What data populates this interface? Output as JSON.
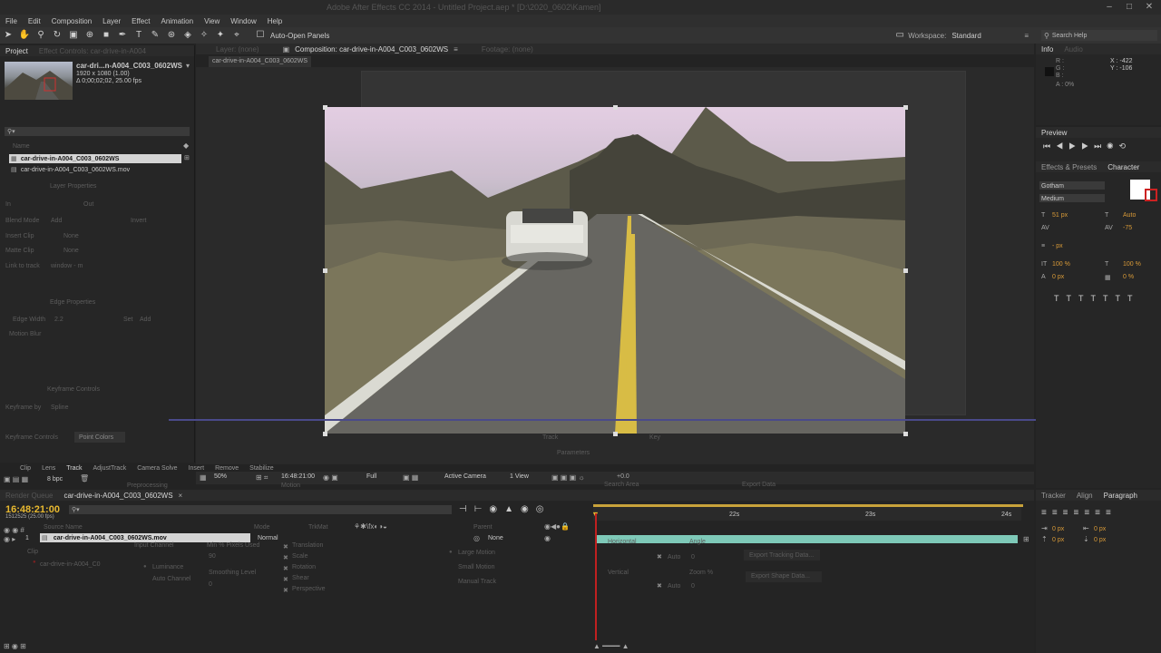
{
  "app_title": "Adobe After Effects CC 2014 - Untitled Project.aep * [D:\\2020_0602\\Kamen]",
  "menu": [
    "File",
    "Edit",
    "Composition",
    "Layer",
    "Effect",
    "Animation",
    "View",
    "Window",
    "Help"
  ],
  "toolbar": {
    "auto_open": "Auto-Open Panels",
    "workspace_label": "Workspace:",
    "workspace_value": "Standard",
    "search_help": "Search Help"
  },
  "project": {
    "tabs": [
      "Project",
      "Effect Controls: car-drive-in-A004"
    ],
    "item_name": "car-dri...n-A004_C003_0602WS",
    "item_res": "1920 x 1080 (1.00)",
    "item_dur": "Δ 0;00;02;02, 25.00 fps",
    "search_placeholder": "",
    "col_name": "Name",
    "row1": "car-drive-in-A004_C003_0602WS",
    "row2": "car-drive-in-A004_C003_0602WS.mov",
    "layer_props": "Layer Properties",
    "in_label": "In",
    "out_label": "Out",
    "blend_mode": "Blend Mode",
    "blend_value": "Add",
    "invert": "Invert",
    "insert_clip": "Insert Clip",
    "insert_value": "None",
    "matte_clip": "Matte Clip",
    "matte_value": "None",
    "link_to_track": "Link to track",
    "link_value": "window - m",
    "edge_props": "Edge Properties",
    "edge_width": "Edge Width",
    "edge_value": "2.2",
    "set": "Set",
    "add": "Add",
    "motion_blur": "Motion Blur",
    "keyframe_controls_hdr": "Keyframe Controls",
    "keyframe_by": "Keyframe by",
    "keyframe_value": "Spline",
    "keyframe_controls_tab": "Keyframe Controls",
    "point_colors_tab": "Point Colors"
  },
  "viewer": {
    "tabs": [
      "Layer: (none)",
      "Composition: car-drive-in-A004_C003_0602WS",
      "Footage: (none)"
    ],
    "subtab": "car-drive-in-A004_C003_0602WS",
    "zoom": "50%",
    "time": "16:48:21:00",
    "resolution": "Full",
    "camera": "Active Camera",
    "view": "1 View",
    "offset": "+0.0",
    "track_label": "Track",
    "key_label": "Key",
    "parameters": "Parameters"
  },
  "lower_tabs": [
    "Clip",
    "Lens",
    "Track",
    "AdjustTrack",
    "Camera Solve",
    "Insert",
    "Remove",
    "Stabilize"
  ],
  "bpc": "8 bpc",
  "timeline": {
    "tabs": [
      "Render Queue",
      "car-drive-in-A004_C003_0602WS"
    ],
    "timecode": "16:48:21:00",
    "fps": "1512525 (25.00 fps)",
    "col_source": "Source Name",
    "col_mode": "Mode",
    "col_trkmat": "TrkMat",
    "col_parent": "Parent",
    "layer_num": "1",
    "layer_name": "car-drive-in-A004_C003_0602WS.mov",
    "layer_mode": "Normal",
    "layer_parent": "None",
    "ruler": [
      "22s",
      "23s",
      "24s"
    ],
    "props": [
      "Translation",
      "Scale",
      "Rotation",
      "Shear",
      "Perspective"
    ],
    "ghost": [
      "Preprocessing",
      "Motion",
      "Search Area",
      "Export Data",
      "Input Channel",
      "Min % Pixels Used",
      "Luminance",
      "Auto Channel",
      "Smoothing Level",
      "Large Motion",
      "Small Motion",
      "Manual Track",
      "Horizontal",
      "Angle",
      "Vertical",
      "Zoom %",
      "Export Tracking Data...",
      "Export Shape Data...",
      "Clip",
      "car-drive-in-A004_C0"
    ],
    "auto": "Auto",
    "zero": "0",
    "ninety": "90"
  },
  "info": {
    "tabs": [
      "Info",
      "Audio"
    ],
    "x": "X : -422",
    "y": "Y : -106",
    "a": "A : 0%",
    "r": "R :",
    "g": "G :",
    "b": "B :"
  },
  "preview": {
    "tab": "Preview"
  },
  "character": {
    "tabs": [
      "Effects & Presets",
      "Character"
    ],
    "font": "Gotham",
    "style": "Medium",
    "size": "51 px",
    "leading": "Auto",
    "tracking": "-75",
    "stroke": "- px",
    "vscale": "100 %",
    "hscale": "100 %",
    "baseline": "0 px",
    "tsume": "0 %"
  },
  "paragraph": {
    "tabs": [
      "Tracker",
      "Align",
      "Paragraph"
    ],
    "v1": "0 px",
    "v2": "0 px",
    "v3": "0 px",
    "v4": "0 px",
    "v5": "0 px"
  }
}
